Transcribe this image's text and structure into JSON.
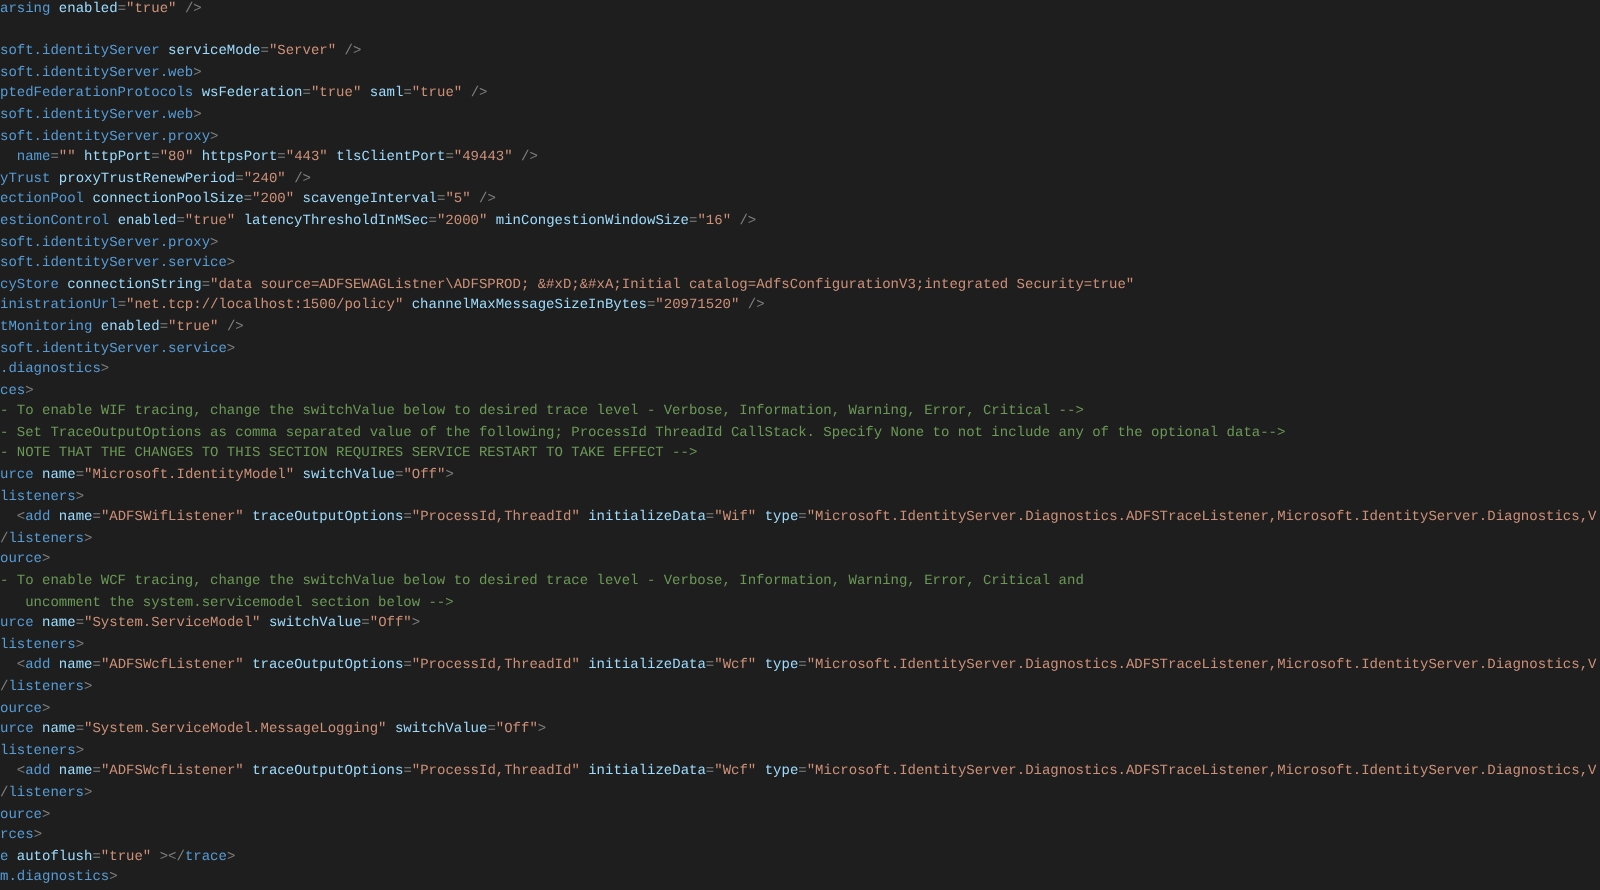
{
  "editor": {
    "lines": [
      {
        "kind": "code",
        "text": "arsing enabled=\"true\" />"
      },
      {
        "kind": "blank"
      },
      {
        "kind": "code",
        "text": "soft.identityServer serviceMode=\"Server\" />"
      },
      {
        "kind": "code",
        "text": "soft.identityServer.web>"
      },
      {
        "kind": "code",
        "text": "ptedFederationProtocols wsFederation=\"true\" saml=\"true\" />"
      },
      {
        "kind": "code",
        "text": "soft.identityServer.web>"
      },
      {
        "kind": "code",
        "text": "soft.identityServer.proxy>"
      },
      {
        "kind": "code",
        "text": "  name=\"\" httpPort=\"80\" httpsPort=\"443\" tlsClientPort=\"49443\" />"
      },
      {
        "kind": "code",
        "text": "yTrust proxyTrustRenewPeriod=\"240\" />"
      },
      {
        "kind": "code",
        "text": "ectionPool connectionPoolSize=\"200\" scavengeInterval=\"5\" />"
      },
      {
        "kind": "code",
        "text": "estionControl enabled=\"true\" latencyThresholdInMSec=\"2000\" minCongestionWindowSize=\"16\" />"
      },
      {
        "kind": "code",
        "text": "soft.identityServer.proxy>"
      },
      {
        "kind": "code",
        "text": "soft.identityServer.service>"
      },
      {
        "kind": "code",
        "text": "cyStore connectionString=\"data source=ADFSEWAGListner\\ADFSPROD; &#xD;&#xA;Initial catalog=AdfsConfigurationV3;integrated Security=true\""
      },
      {
        "kind": "code",
        "text": "inistrationUrl=\"net.tcp://localhost:1500/policy\" channelMaxMessageSizeInBytes=\"20971520\" />"
      },
      {
        "kind": "code",
        "text": "tMonitoring enabled=\"true\" />"
      },
      {
        "kind": "code",
        "text": "soft.identityServer.service>"
      },
      {
        "kind": "code",
        "text": ".diagnostics>"
      },
      {
        "kind": "code",
        "text": "ces>"
      },
      {
        "kind": "comment",
        "text": "- To enable WIF tracing, change the switchValue below to desired trace level - Verbose, Information, Warning, Error, Critical -->"
      },
      {
        "kind": "comment",
        "text": "- Set TraceOutputOptions as comma separated value of the following; ProcessId ThreadId CallStack. Specify None to not include any of the optional data-->"
      },
      {
        "kind": "comment",
        "text": "- NOTE THAT THE CHANGES TO THIS SECTION REQUIRES SERVICE RESTART TO TAKE EFFECT -->"
      },
      {
        "kind": "code",
        "text": "urce name=\"Microsoft.IdentityModel\" switchValue=\"Off\">"
      },
      {
        "kind": "code",
        "text": "listeners>"
      },
      {
        "kind": "code",
        "text": "  <add name=\"ADFSWifListener\" traceOutputOptions=\"ProcessId,ThreadId\" initializeData=\"Wif\" type=\"Microsoft.IdentityServer.Diagnostics.ADFSTraceListener,Microsoft.IdentityServer.Diagnostics,V"
      },
      {
        "kind": "code",
        "text": "/listeners>"
      },
      {
        "kind": "code",
        "text": "ource>"
      },
      {
        "kind": "comment",
        "text": "- To enable WCF tracing, change the switchValue below to desired trace level - Verbose, Information, Warning, Error, Critical and"
      },
      {
        "kind": "comment",
        "text": "   uncomment the system.servicemodel section below -->"
      },
      {
        "kind": "code",
        "text": "urce name=\"System.ServiceModel\" switchValue=\"Off\">"
      },
      {
        "kind": "code",
        "text": "listeners>"
      },
      {
        "kind": "code",
        "text": "  <add name=\"ADFSWcfListener\" traceOutputOptions=\"ProcessId,ThreadId\" initializeData=\"Wcf\" type=\"Microsoft.IdentityServer.Diagnostics.ADFSTraceListener,Microsoft.IdentityServer.Diagnostics,V"
      },
      {
        "kind": "code",
        "text": "/listeners>"
      },
      {
        "kind": "code",
        "text": "ource>"
      },
      {
        "kind": "code",
        "text": "urce name=\"System.ServiceModel.MessageLogging\" switchValue=\"Off\">"
      },
      {
        "kind": "code",
        "text": "listeners>"
      },
      {
        "kind": "code",
        "text": "  <add name=\"ADFSWcfListener\" traceOutputOptions=\"ProcessId,ThreadId\" initializeData=\"Wcf\" type=\"Microsoft.IdentityServer.Diagnostics.ADFSTraceListener,Microsoft.IdentityServer.Diagnostics,V"
      },
      {
        "kind": "code",
        "text": "/listeners>"
      },
      {
        "kind": "code",
        "text": "ource>"
      },
      {
        "kind": "code",
        "text": "rces>"
      },
      {
        "kind": "code",
        "text": "e autoflush=\"true\" ></trace>"
      },
      {
        "kind": "code",
        "text": "m.diagnostics>"
      }
    ]
  }
}
